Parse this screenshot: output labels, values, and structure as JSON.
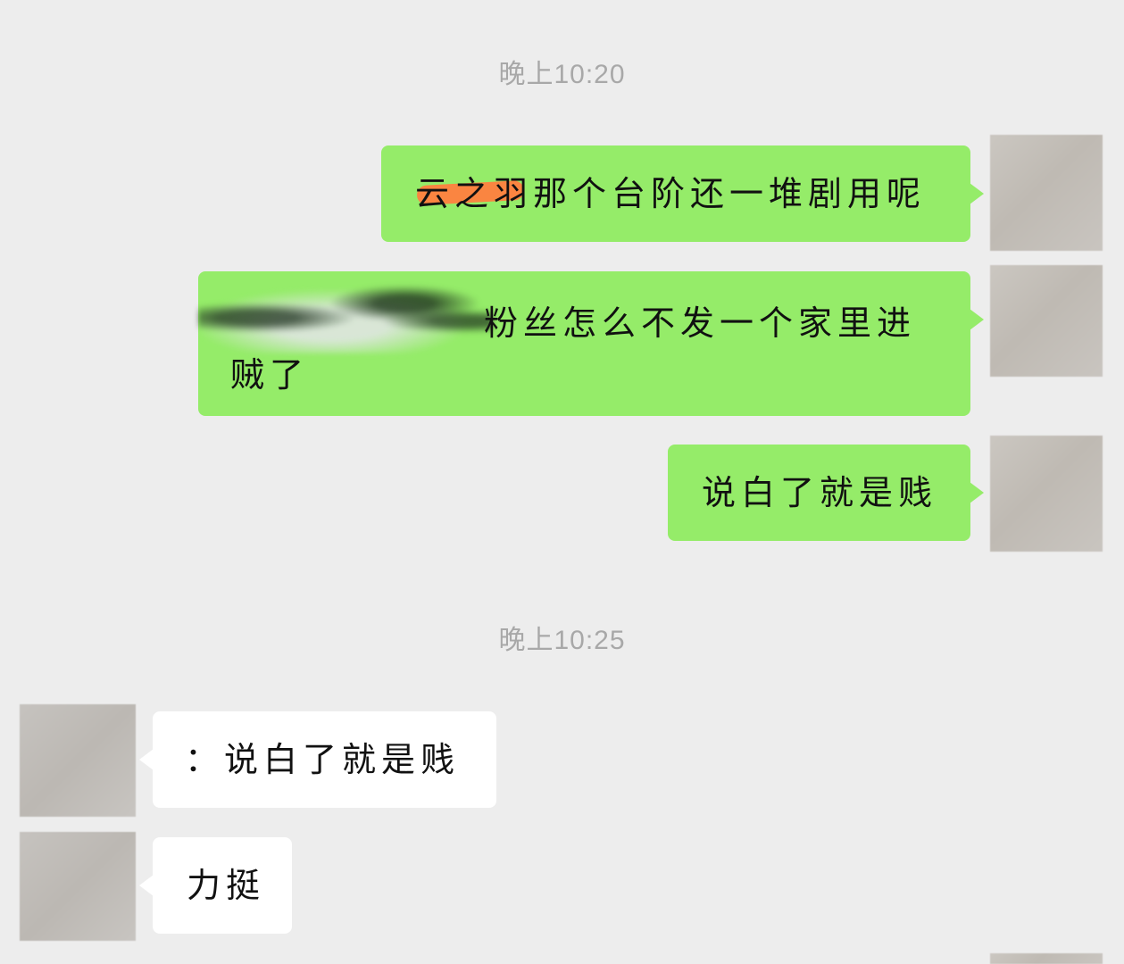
{
  "timestamps": [
    "晚上10:20",
    "晚上10:25"
  ],
  "messages": [
    {
      "side": "out",
      "text": "云之羽那个台阶还一堆剧用呢",
      "redacted": "orange-strike"
    },
    {
      "side": "out",
      "text": "粉丝怎么不发一个家里进贼了",
      "redacted": "blur"
    },
    {
      "side": "out",
      "text": "说白了就是贱"
    },
    {
      "side": "in",
      "text": "：说白了就是贱"
    },
    {
      "side": "in",
      "text": "力挺"
    }
  ],
  "colors": {
    "background": "#ededed",
    "outgoing_bubble": "#95ec69",
    "incoming_bubble": "#ffffff",
    "timestamp": "#a8a8a8",
    "redaction_orange": "#ff7f3f"
  }
}
